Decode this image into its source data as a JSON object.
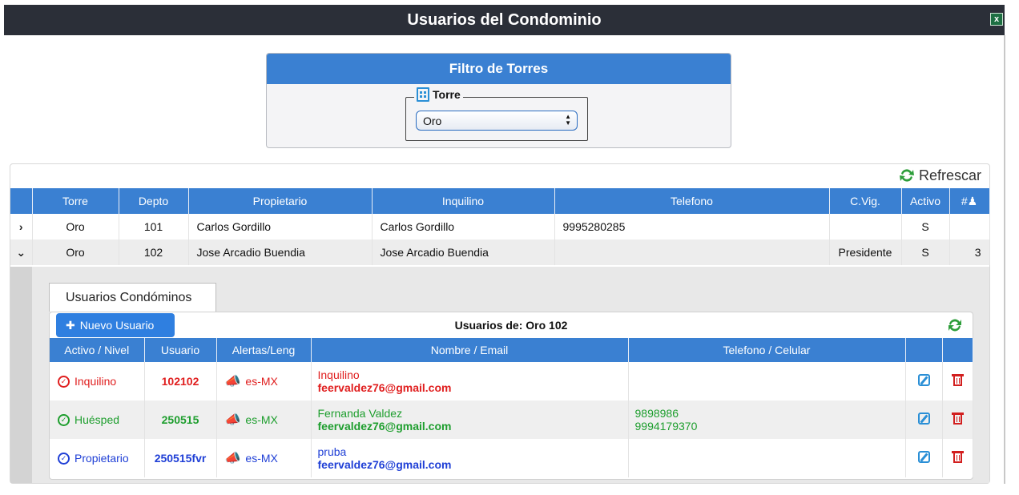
{
  "app": {
    "title": "Usuarios del Condominio"
  },
  "filter": {
    "title": "Filtro de Torres",
    "legend": "Torre",
    "selected": "Oro"
  },
  "toolbar": {
    "refresh_label": "Refrescar"
  },
  "main_table": {
    "headers": [
      "Torre",
      "Depto",
      "Propietario",
      "Inquilino",
      "Telefono",
      "C.Vig.",
      "Activo",
      "#"
    ],
    "rows": [
      {
        "expander": "›",
        "torre": "Oro",
        "depto": "101",
        "propietario": "Carlos Gordillo",
        "inquilino": "Carlos Gordillo",
        "telefono": "9995280285",
        "cvig": "",
        "activo": "S",
        "count": ""
      },
      {
        "expander": "⌄",
        "torre": "Oro",
        "depto": "102",
        "propietario": "Jose Arcadio Buendia",
        "inquilino": "Jose Arcadio Buendia",
        "telefono": "",
        "cvig": "Presidente",
        "activo": "S",
        "count": "3"
      }
    ]
  },
  "detail": {
    "tab_label": "Usuarios Condóminos",
    "new_user_label": "Nuevo Usuario",
    "subtitle": "Usuarios de: Oro 102",
    "headers": [
      "Activo / Nivel",
      "Usuario",
      "Alertas/Leng",
      "Nombre / Email",
      "Telefono / Celular"
    ],
    "users": [
      {
        "nivel": "Inquilino",
        "usuario": "102102",
        "lang": "es-MX",
        "nombre": "Inquilino",
        "email": "feervaldez76@gmail.com",
        "telefono": "",
        "celular": "",
        "color": "#e01e1e"
      },
      {
        "nivel": "Huésped",
        "usuario": "250515",
        "lang": "es-MX",
        "nombre": "Fernanda Valdez",
        "email": "feervaldez76@gmail.com",
        "telefono": "9898986",
        "celular": "9994179370",
        "color": "#1e9e2e"
      },
      {
        "nivel": "Propietario",
        "usuario": "250515fvr",
        "lang": "es-MX",
        "nombre": "pruba",
        "email": "feervaldez76@gmail.com",
        "telefono": "",
        "celular": "",
        "color": "#1f3fd6"
      }
    ]
  },
  "colors": {
    "header_bar": "#2b2f38",
    "accent": "#3a80d2",
    "inquilino": "#e01e1e",
    "huesped": "#1e9e2e",
    "propietario": "#1f3fd6"
  }
}
